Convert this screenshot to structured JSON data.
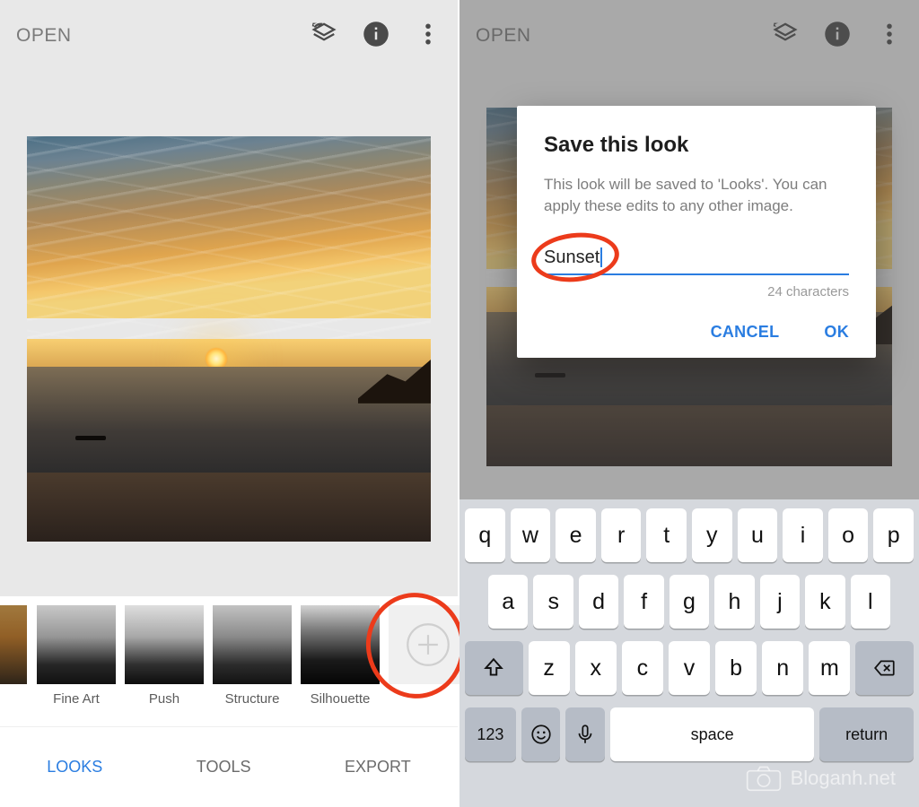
{
  "watermark": "Bloganh.net",
  "left": {
    "open_label": "OPEN",
    "looks": [
      {
        "label": ""
      },
      {
        "label": "Fine Art"
      },
      {
        "label": "Push"
      },
      {
        "label": "Structure"
      },
      {
        "label": "Silhouette"
      },
      {
        "label": ""
      }
    ],
    "tabs": {
      "looks": "LOOKS",
      "tools": "TOOLS",
      "export": "EXPORT"
    }
  },
  "right": {
    "open_label": "OPEN",
    "dialog": {
      "title": "Save this look",
      "body": "This look will be saved to 'Looks'. You can apply these edits to any other image.",
      "input_value": "Sunset",
      "counter": "24 characters",
      "cancel": "CANCEL",
      "ok": "OK"
    },
    "keyboard": {
      "r1": [
        "q",
        "w",
        "e",
        "r",
        "t",
        "y",
        "u",
        "i",
        "o",
        "p"
      ],
      "r2": [
        "a",
        "s",
        "d",
        "f",
        "g",
        "h",
        "j",
        "k",
        "l"
      ],
      "r3": [
        "z",
        "x",
        "c",
        "v",
        "b",
        "n",
        "m"
      ],
      "num": "123",
      "space": "space",
      "ret": "return"
    }
  }
}
